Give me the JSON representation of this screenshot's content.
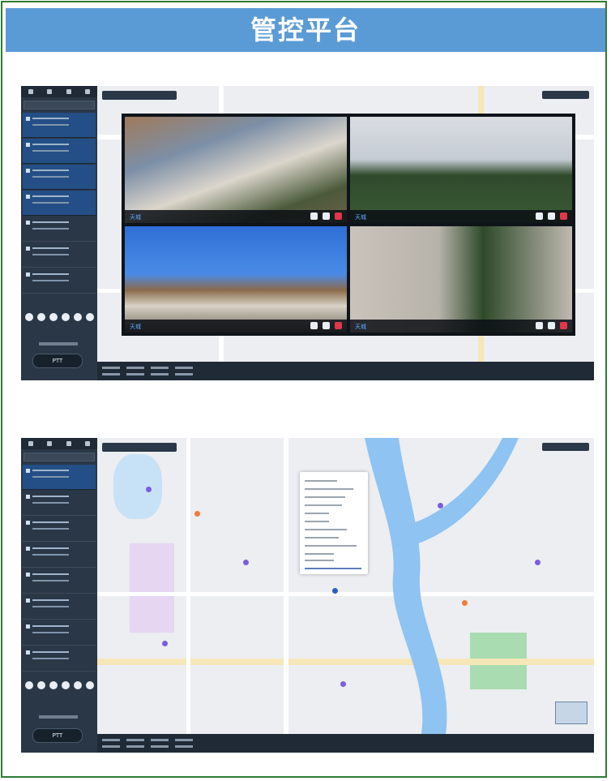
{
  "banner": {
    "title": "管控平台"
  },
  "screenshot1": {
    "ptt_label": "PTT",
    "video_label": "天城",
    "colors": {
      "panel": "#2a3746",
      "selected": "#244f86",
      "video_label": "#5fa9ff",
      "hangup": "#e0384a"
    }
  },
  "screenshot2": {
    "ptt_label": "PTT",
    "colors": {
      "river": "#8ec3f2",
      "park": "#a9dcb0",
      "district": "#e6d6f2",
      "pin": "#7c5ce0"
    }
  }
}
